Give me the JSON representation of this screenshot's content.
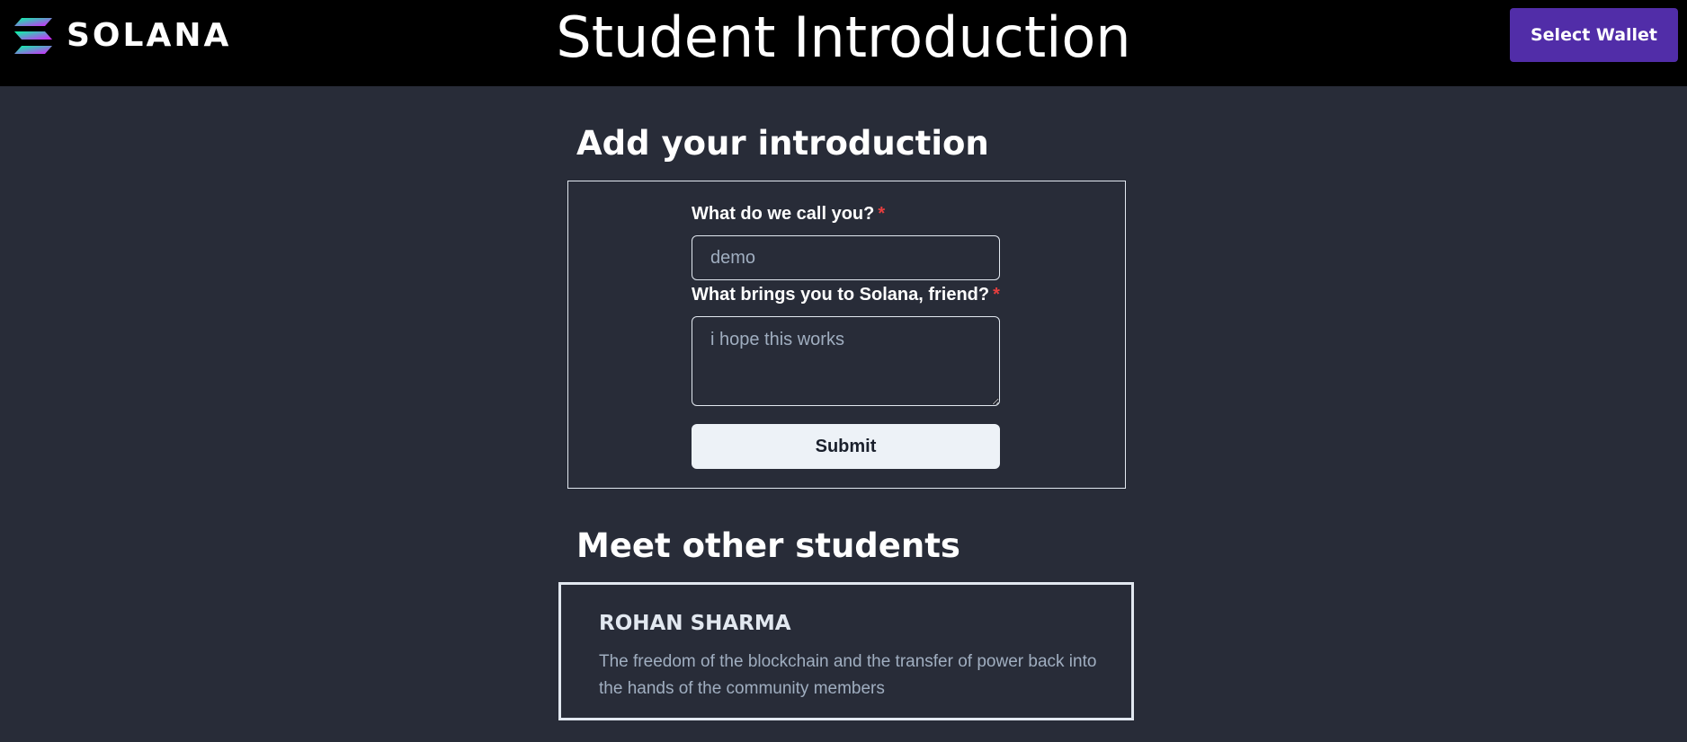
{
  "header": {
    "logo_text": "SOLANA",
    "title": "Student Introduction",
    "wallet_button_label": "Select Wallet"
  },
  "form": {
    "heading": "Add your introduction",
    "name_label": "What do we call you?",
    "name_required_mark": "*",
    "name_value": "demo",
    "reason_label": "What brings you to Solana, friend?",
    "reason_required_mark": "*",
    "reason_value": "i hope this works",
    "submit_label": "Submit"
  },
  "students": {
    "heading": "Meet other students",
    "items": [
      {
        "name": "ROHAN SHARMA",
        "message": "The freedom of the blockchain and the transfer of power back into the hands of the community members"
      }
    ]
  },
  "colors": {
    "page_background": "#282c38",
    "header_background": "#000000",
    "wallet_button": "#512da8",
    "required_mark": "#e53e3e",
    "submit_button": "#edf2f7"
  },
  "icons": {
    "logo": "solana-logo-icon"
  }
}
